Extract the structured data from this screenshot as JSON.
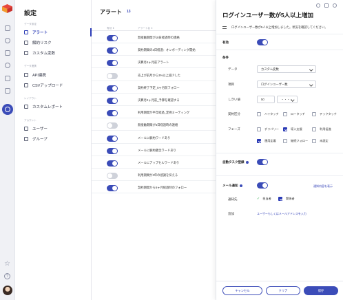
{
  "sidebar": {
    "title": "設定",
    "sections": [
      "データ設定",
      "データ連携",
      "レイアウト",
      "アカウント"
    ],
    "items": [
      "アラート",
      "解約リスク",
      "カスタム変数",
      "API連携",
      "CSVアップロード",
      "カスタムレポート",
      "ユーザー",
      "グループ"
    ]
  },
  "alerts": {
    "title": "アラート",
    "count": "13",
    "col_enabled": "有効 ⇕",
    "col_name": "アラート名 ⇕",
    "rows": [
      {
        "name": "無接触期間が18日経過時の連絡",
        "on": true
      },
      {
        "name": "契約期間の3日経過：オンボーディング開始",
        "on": true
      },
      {
        "name": "決算月4ヶ月前アラート",
        "on": true
      },
      {
        "name": "売上が前月から3%以上減少した",
        "on": false
      },
      {
        "name": "契約終了予定_5ヶ月前フォロー",
        "on": true
      },
      {
        "name": "決算月2ヶ月前_予算を確認する",
        "on": true
      },
      {
        "name": "利用期間が半年経過_定例ミーティング",
        "on": true
      },
      {
        "name": "無接触期間が5日経過時の連絡",
        "on": false
      },
      {
        "name": "メールに解約ワードあり",
        "on": true
      },
      {
        "name": "メールに解約懸念ワードあり",
        "on": true
      },
      {
        "name": "メールにアップセルワードあり",
        "on": true
      },
      {
        "name": "利用期間が3年の感謝を伝える",
        "on": false
      },
      {
        "name": "契約期間から6ヶ月経過時のフォロー",
        "on": true
      }
    ]
  },
  "detail": {
    "title": "ログインユーザー数が5人以上増加",
    "description": "ログインユーザー数が5人以上増加しました。状況を確認してください。",
    "enabled_label": "有効",
    "enabled": true,
    "conditions_label": "条件",
    "data_label": "データ",
    "data_value": "カスタム変数",
    "item_label": "項目",
    "item_value": "ログインユーザー数",
    "threshold_label": "しきい値",
    "threshold_value": "50",
    "threshold_unit": "・・・・",
    "contract_label": "契約区分",
    "contract_options": [
      {
        "label": "ハイタッチ",
        "checked": false
      },
      {
        "label": "ロータッチ",
        "checked": false
      },
      {
        "label": "テックタッチ",
        "checked": false
      }
    ],
    "phase_label": "フェーズ",
    "phase_options": [
      {
        "label": "デリバリー",
        "checked": false
      },
      {
        "label": "導入支援",
        "checked": true
      },
      {
        "label": "利用促進",
        "checked": false
      },
      {
        "label": "運用定着",
        "checked": true
      },
      {
        "label": "継続フォロー",
        "checked": false
      },
      {
        "label": "未設定",
        "checked": false
      }
    ],
    "auto_task_label": "自動タスク登録",
    "auto_task": true,
    "mail_label": "メール通知",
    "mail_on": true,
    "mail_link": "通知内容を表示",
    "notify_to_label": "通知先",
    "notify_owner": "担当者",
    "notify_related": "関係者",
    "add_label": "追加",
    "add_placeholder": "ユーザーもしくはメールアドレスを入力",
    "cancel": "キャンセル",
    "clear": "クリア",
    "save": "保存"
  }
}
